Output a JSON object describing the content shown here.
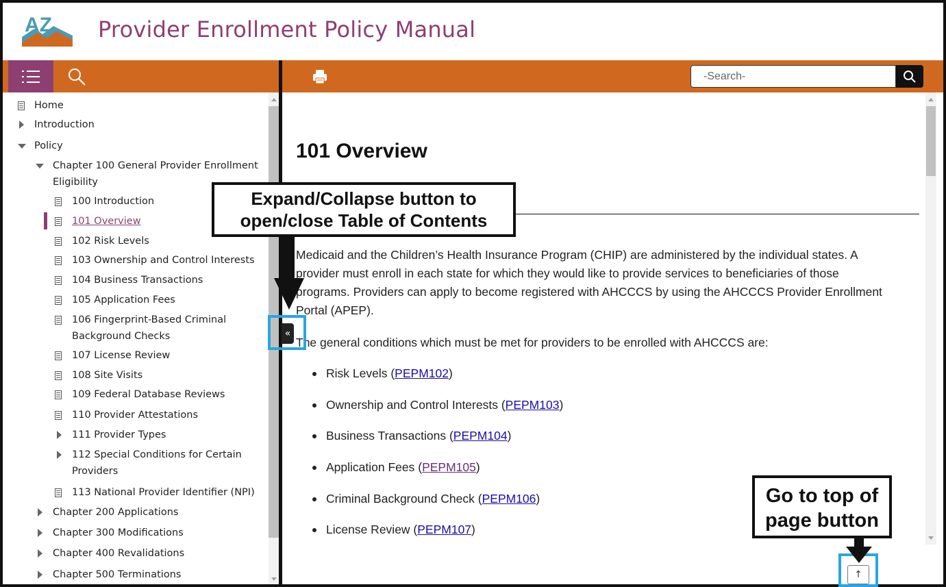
{
  "header": {
    "logo_text": "AZ",
    "title": "Provider Enrollment Policy Manual"
  },
  "toolbar": {
    "search_placeholder": "-Search-"
  },
  "colors": {
    "toolbar": "#d0691f",
    "accent": "#8e3f72",
    "callout_border": "#111111",
    "highlight": "#29a6e0"
  },
  "toc": {
    "home": "Home",
    "introduction": "Introduction",
    "policy": "Policy",
    "ch100": "Chapter 100 General Provider Enrollment",
    "ch100_cont": "Eligibility",
    "items": [
      "100 Introduction",
      "101 Overview",
      "102 Risk Levels",
      "103 Ownership and Control Interests",
      "104 Business Transactions",
      "105 Application Fees",
      "106 Fingerprint-Based Criminal",
      "Background Checks",
      "107 License Review",
      "108 Site Visits",
      "109 Federal Database Reviews",
      "110 Provider Attestations",
      "111 Provider Types",
      "112 Special Conditions for Certain",
      "Providers",
      "113 National Provider Identifier (NPI)"
    ],
    "chapters": [
      "Chapter 200 Applications",
      "Chapter 300 Modifications",
      "Chapter 400 Revalidations",
      "Chapter 500 Terminations"
    ]
  },
  "content": {
    "heading": "101 Overview",
    "para1": [
      "Medicaid and the Children’s Health Insurance Program (CHIP) are administered by the individual states. A",
      "provider must enroll in each state for which they would like to provide services to beneficiaries of those",
      "programs. Providers can apply to become registered with AHCCCS by using the AHCCCS Provider Enrollment",
      "Portal (APEP)."
    ],
    "para2": "The general conditions which must be met for providers to be enrolled with AHCCCS are:",
    "bullets": [
      {
        "text": "Risk Levels (",
        "link": "PEPM102",
        "close": ")"
      },
      {
        "text": "Ownership and Control Interests (",
        "link": "PEPM103",
        "close": ")"
      },
      {
        "text": "Business Transactions (",
        "link": "PEPM104",
        "close": ")"
      },
      {
        "text": "Application Fees (",
        "link": "PEPM105",
        "close": ")"
      },
      {
        "text": "Criminal Background Check (",
        "link": "PEPM106",
        "close": ")"
      },
      {
        "text": "License Review (",
        "link": "PEPM107",
        "close": ")"
      }
    ]
  },
  "expand_button": {
    "label": "«"
  },
  "top_button": {
    "label": "↑"
  },
  "callouts": {
    "expand_line1": "Expand/Collapse button to",
    "expand_line2": "open/close Table of Contents",
    "top_line1": "Go to top of",
    "top_line2": "page button"
  }
}
